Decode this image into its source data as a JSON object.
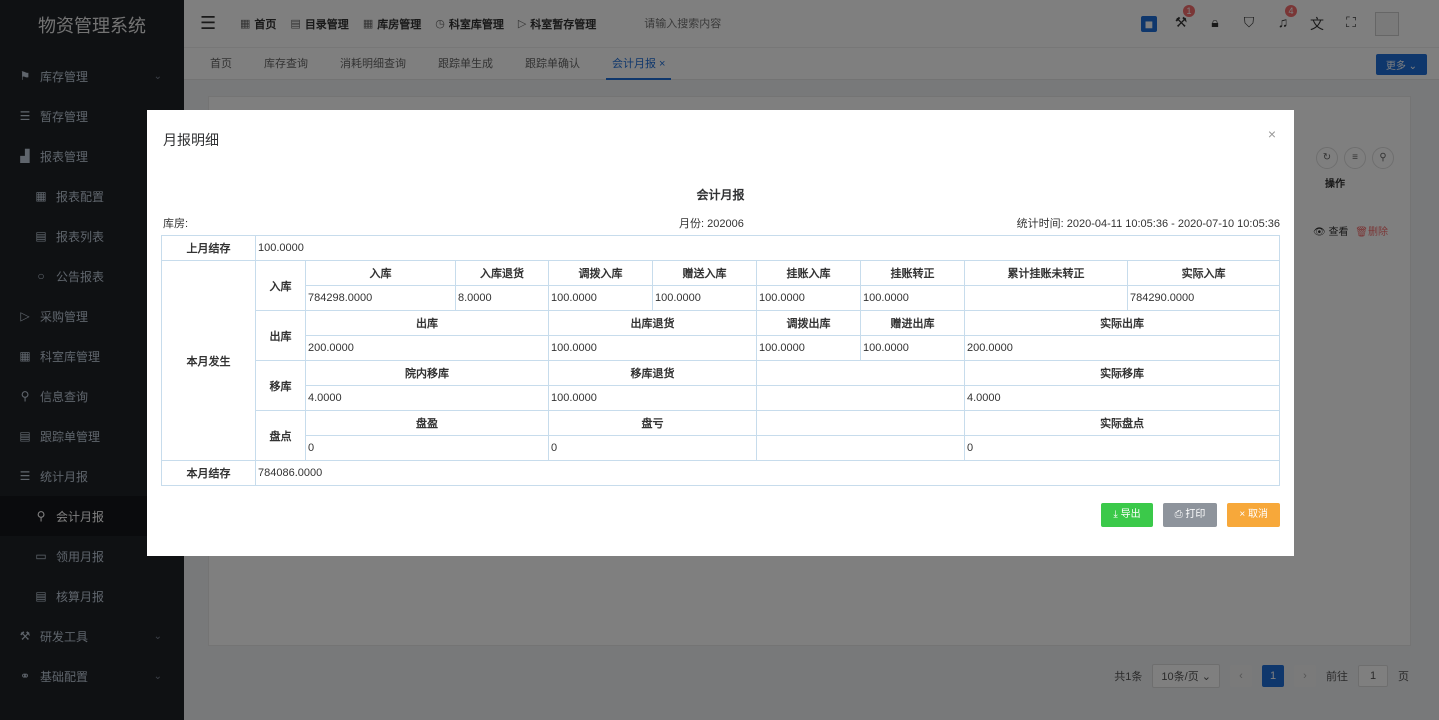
{
  "app": {
    "title": "物资管理系统"
  },
  "sidebar": {
    "items": [
      {
        "label": "库存管理",
        "icon": "flag-icon",
        "arrow": true
      },
      {
        "label": "暂存管理",
        "icon": "list-icon"
      },
      {
        "label": "报表管理",
        "icon": "chart-icon"
      },
      {
        "label": "报表配置",
        "icon": "grid-icon",
        "sub": true
      },
      {
        "label": "报表列表",
        "icon": "doc-icon",
        "sub": true
      },
      {
        "label": "公告报表",
        "icon": "circle-icon",
        "sub": true
      },
      {
        "label": "采购管理",
        "icon": "send-icon"
      },
      {
        "label": "科室库管理",
        "icon": "grid-icon"
      },
      {
        "label": "信息查询",
        "icon": "search-icon"
      },
      {
        "label": "跟踪单管理",
        "icon": "doc-icon"
      },
      {
        "label": "统计月报",
        "icon": "list-icon"
      },
      {
        "label": "会计月报",
        "icon": "search-icon",
        "sub": true,
        "active": true
      },
      {
        "label": "领用月报",
        "icon": "monitor-icon",
        "sub": true
      },
      {
        "label": "核算月报",
        "icon": "doc-icon",
        "sub": true
      },
      {
        "label": "研发工具",
        "icon": "tool-icon",
        "arrow": true
      },
      {
        "label": "基础配置",
        "icon": "link-icon",
        "arrow": true
      }
    ]
  },
  "header": {
    "nav": [
      {
        "label": "首页",
        "icon": "grid-icon"
      },
      {
        "label": "目录管理",
        "icon": "doc-icon"
      },
      {
        "label": "库房管理",
        "icon": "grid-icon"
      },
      {
        "label": "科室库管理",
        "icon": "clock-icon"
      },
      {
        "label": "科室暂存管理",
        "icon": "send-icon"
      }
    ],
    "search_placeholder": "请输入搜索内容",
    "badges": {
      "a": "1",
      "b": "4"
    }
  },
  "tags": [
    "首页",
    "库存查询",
    "消耗明细查询",
    "跟踪单生成",
    "跟踪单确认",
    "会计月报 ×"
  ],
  "more_label": "更多",
  "table_header": {
    "ops": "操作"
  },
  "row_ops": {
    "view": "查看",
    "delete": "删除"
  },
  "pager": {
    "total": "共1条",
    "size": "10条/页",
    "page": "1",
    "goto": "前往",
    "goto_value": "1",
    "page_unit": "页"
  },
  "modal": {
    "title": "月报明细",
    "close": "×",
    "report_title": "会计月报",
    "warehouse_label": "库房:",
    "month": "月份: 202006",
    "stat_time": "统计时间: 2020-04-11 10:05:36 - 2020-07-10 10:05:36",
    "labels": {
      "last_month": "上月结存",
      "this_month": "本月发生",
      "end_month": "本月结存",
      "in": "入库",
      "out": "出库",
      "move": "移库",
      "check": "盘点"
    },
    "last_month_value": "100.0000",
    "end_month_value": "784086.0000",
    "in_headers": [
      "入库",
      "入库退货",
      "调拨入库",
      "赠送入库",
      "挂账入库",
      "挂账转正",
      "累计挂账未转正",
      "实际入库"
    ],
    "in_values": [
      "784298.0000",
      "8.0000",
      "100.0000",
      "100.0000",
      "100.0000",
      "100.0000",
      "",
      "784290.0000"
    ],
    "out_headers": [
      "出库",
      "出库退货",
      "调拨出库",
      "赠进出库",
      "实际出库"
    ],
    "out_values": [
      "200.0000",
      "100.0000",
      "100.0000",
      "100.0000",
      "200.0000"
    ],
    "move_headers": [
      "院内移库",
      "移库退货",
      "",
      "实际移库"
    ],
    "move_values": [
      "4.0000",
      "100.0000",
      "",
      "4.0000"
    ],
    "check_headers": [
      "盘盈",
      "盘亏",
      "",
      "实际盘点"
    ],
    "check_values": [
      "0",
      "0",
      "",
      "0"
    ],
    "buttons": {
      "export": "导出",
      "print": "打印",
      "cancel": "取消"
    }
  }
}
